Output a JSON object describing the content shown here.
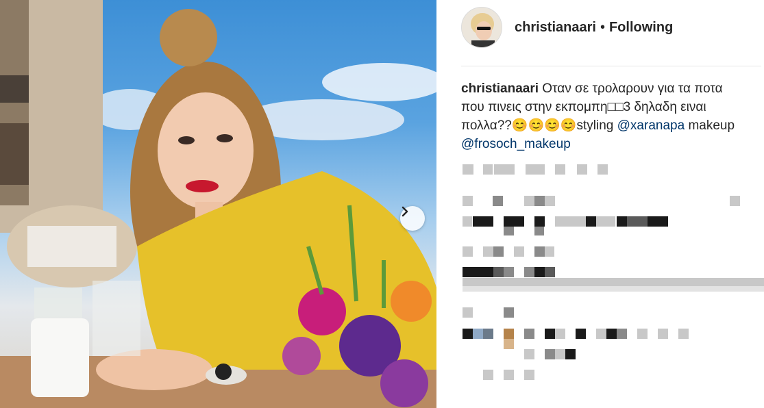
{
  "post": {
    "username": "christianaari",
    "separator": "•",
    "follow_label": "Following"
  },
  "caption": {
    "username": "christianaari",
    "text_1": "Οταν σε τρολαρουν για τα ποτα που πινεις στην εκπομπη□□3 δηλαδη ειναι πολλα??😊😊😊😊styling ",
    "mention_1": "@xaranapa",
    "text_2": " makeup ",
    "mention_2": "@frosoch_makeup"
  },
  "icons": {
    "next": "chevron-right-icon",
    "avatar": "avatar-image"
  },
  "colors": {
    "mention": "#003569",
    "divider": "#e6e6e6",
    "pixelated_dark": "#1a1a1a",
    "pixelated_light": "#c8c8c8"
  }
}
